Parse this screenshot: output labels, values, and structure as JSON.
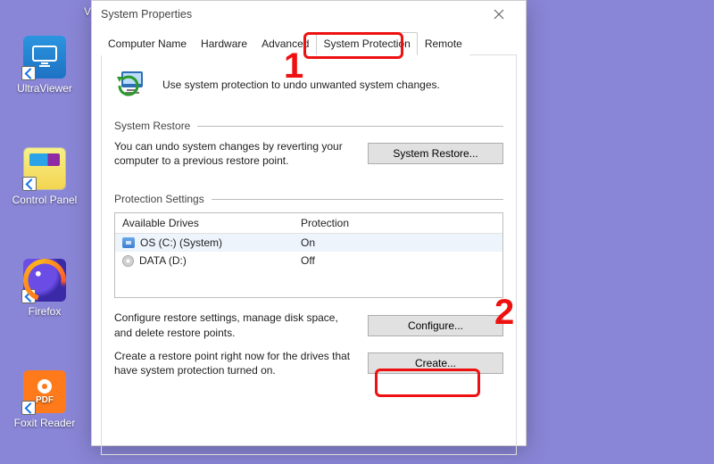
{
  "desktop": {
    "icons": [
      {
        "label": "UltraViewer"
      },
      {
        "label": "Control Panel"
      },
      {
        "label": "Firefox"
      },
      {
        "label": "Foxit Reader"
      }
    ]
  },
  "dialog": {
    "title": "System Properties",
    "tabs": [
      "Computer Name",
      "Hardware",
      "Advanced",
      "System Protection",
      "Remote"
    ],
    "active_tab_index": 3,
    "intro": "Use system protection to undo unwanted system changes.",
    "system_restore": {
      "legend": "System Restore",
      "desc": "You can undo system changes by reverting your computer to a previous restore point.",
      "button": "System Restore..."
    },
    "protection_settings": {
      "legend": "Protection Settings",
      "col_a": "Available Drives",
      "col_b": "Protection",
      "rows": [
        {
          "name": "OS (C:) (System)",
          "status": "On"
        },
        {
          "name": "DATA (D:)",
          "status": "Off"
        }
      ],
      "configure_desc": "Configure restore settings, manage disk space, and delete restore points.",
      "configure_btn": "Configure...",
      "create_desc": "Create a restore point right now for the drives that have system protection turned on.",
      "create_btn": "Create..."
    }
  },
  "annotations": {
    "num1": "1",
    "num2": "2"
  }
}
